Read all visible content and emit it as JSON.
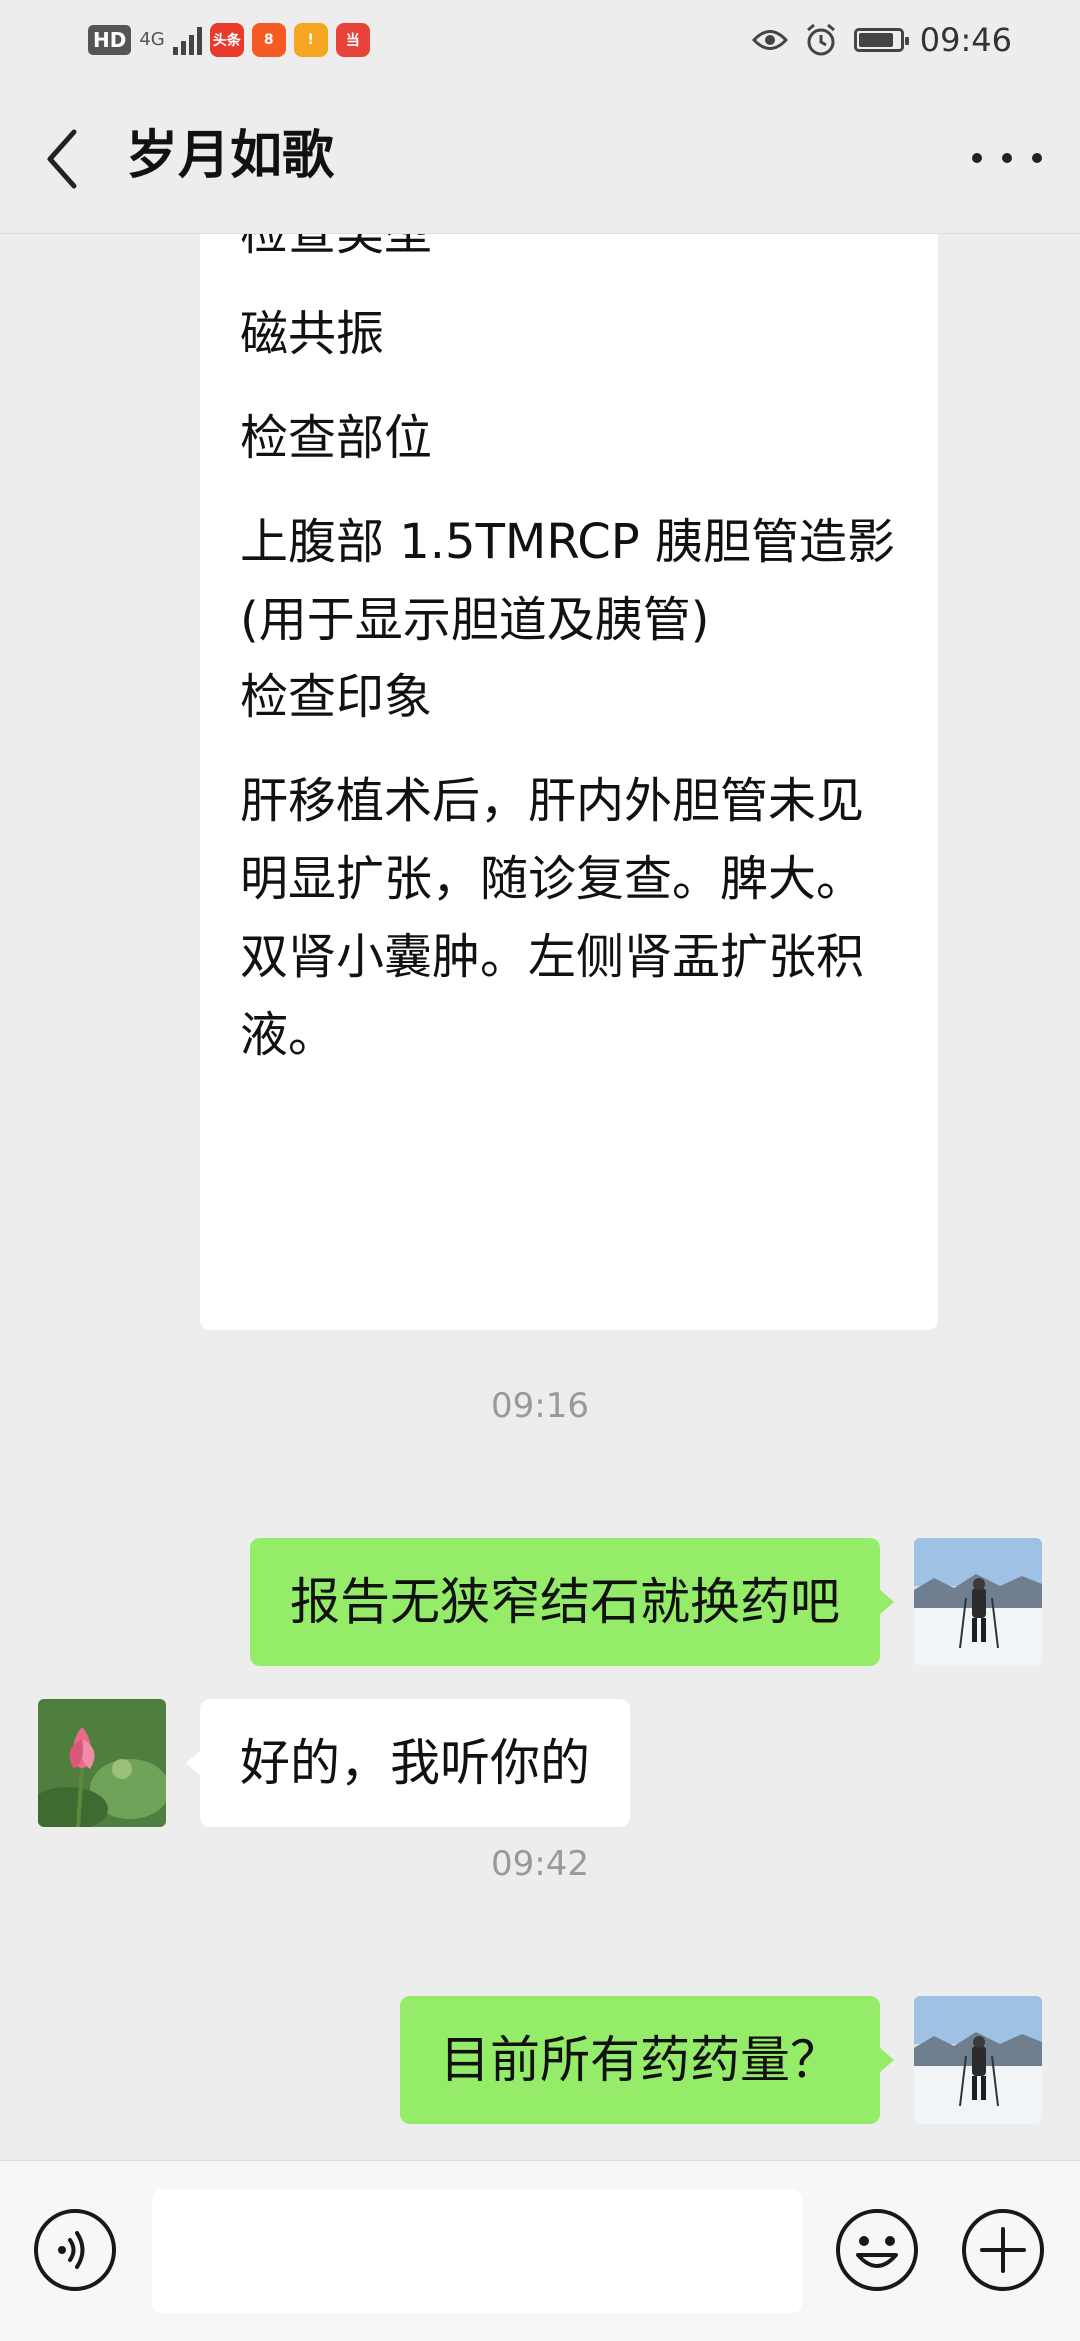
{
  "status_bar": {
    "left_badge": "HD",
    "network": "4G",
    "apps": [
      {
        "name": "toutiao-app-icon",
        "label": "头条",
        "color": "#e93a2e"
      },
      {
        "name": "xiaohongshu-app-icon",
        "label": "8",
        "color": "#f55b23"
      },
      {
        "name": "pinduoduo-app-icon",
        "label": "!",
        "color": "#f6a623"
      },
      {
        "name": "jd-app-icon",
        "label": "当",
        "color": "#e8433a"
      }
    ],
    "time": "09:46",
    "battery_level": 0.85
  },
  "header": {
    "title": "岁月如歌"
  },
  "messages": {
    "long_report": {
      "cut_text": "检查类型",
      "type_value": "磁共振",
      "part_label": "检查部位",
      "part_value": "上腹部 1.5TMRCP 胰胆管造影(用于显示胆道及胰管)",
      "impression_label": "检查印象",
      "impression_value": "肝移植术后，肝内外胆管未见明显扩张，随诊复查。脾大。双肾小囊肿。左侧肾盂扩张积液。"
    },
    "time_1": "09:16",
    "out_1": "报告无狭窄结石就换药吧",
    "in_1": "好的，我听你的",
    "time_2": "09:42",
    "out_2": "目前所有药药量？"
  },
  "input_bar": {
    "value": "",
    "placeholder": ""
  },
  "colors": {
    "background": "#ededed",
    "outgoing_bubble": "#95ec69",
    "incoming_bubble": "#ffffff"
  }
}
